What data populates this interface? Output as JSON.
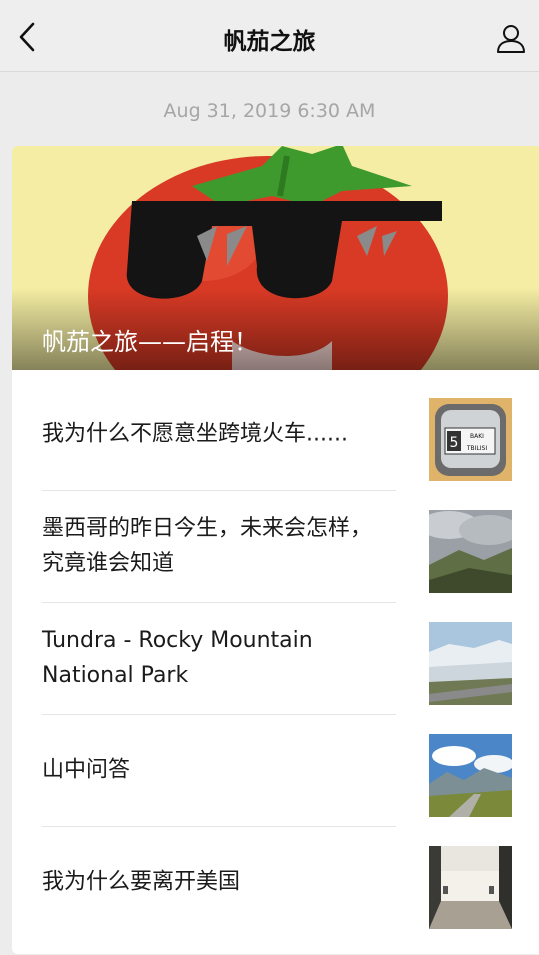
{
  "header": {
    "title": "帆茄之旅",
    "back_icon": "chevron-left-icon",
    "profile_icon": "person-icon"
  },
  "message": {
    "timestamp": "Aug 31, 2019 6:30 AM"
  },
  "cover": {
    "title": "帆茄之旅——启程！",
    "image": "tomato-with-sunglasses-illustration"
  },
  "articles": [
    {
      "title": "我为什么不愿意坐跨境火车......",
      "thumbnail": "train-window-sign",
      "thumb_text": [
        "5",
        "BAKI",
        "TBILISI"
      ]
    },
    {
      "title": "墨西哥的昨日今生，未来会怎样，究竟谁会知道",
      "thumbnail": "cloudy-mountains"
    },
    {
      "title": "Tundra  - Rocky Mountain National Park",
      "thumbnail": "snowy-road-landscape"
    },
    {
      "title": "山中问答",
      "thumbnail": "mountain-valley"
    },
    {
      "title": "我为什么要离开美国",
      "thumbnail": "courtyard-building"
    }
  ],
  "colors": {
    "background": "#ececec",
    "card": "#ffffff",
    "timestamp": "#a6a6a6",
    "tomato": "#d93a25"
  }
}
